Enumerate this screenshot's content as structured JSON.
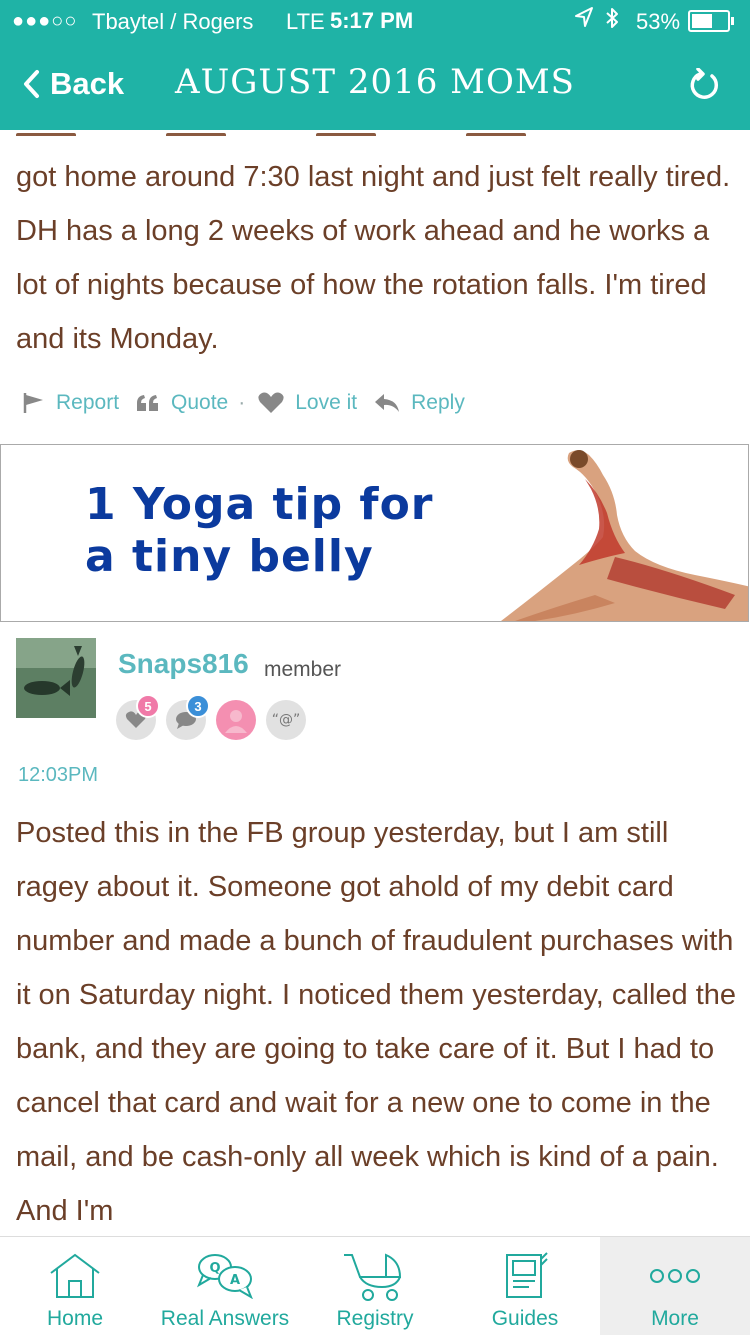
{
  "status_bar": {
    "signal": "●●●○○",
    "carrier": "Tbaytel / Rogers",
    "network": "LTE",
    "time": "5:17 PM",
    "battery": "53%",
    "battery_level": 0.53
  },
  "nav": {
    "back_label": "Back",
    "title": "AUGUST 2016 MOMS"
  },
  "previous_post": {
    "text": "got home around 7:30 last night and just felt really tired. DH has a long 2 weeks of work ahead and he works a lot of nights because of how the rotation falls. I'm tired and its Monday.",
    "actions": {
      "report": "Report",
      "quote": "Quote",
      "separator": "·",
      "love": "Love it",
      "reply": "Reply"
    }
  },
  "ad": {
    "line1": "1 Yoga tip for",
    "line2": "a tiny belly"
  },
  "comment": {
    "username": "Snaps816",
    "role": "member",
    "badges": [
      {
        "icon": "heart-icon",
        "count": "5",
        "color": "#f07aa8"
      },
      {
        "icon": "chat-bubble-icon",
        "count": "3",
        "color": "#3b8fd8"
      },
      {
        "icon": "person-icon",
        "count": "",
        "color": "#f48fb1"
      },
      {
        "icon": "mention-icon",
        "label": "“@”"
      }
    ],
    "time": "12:03PM",
    "text": "Posted this in the FB group yesterday, but I am still ragey about it. Someone got ahold of my debit card number and made a bunch of fraudulent purchases with it on Saturday night. I noticed them yesterday, called the bank, and they are going to take care of it. But I had to cancel that card and wait for a new one to come in the mail, and be cash-only all week which is kind of a pain. And I'm"
  },
  "tabbar": {
    "tabs": [
      {
        "label": "Home",
        "icon": "home-icon"
      },
      {
        "label": "Real Answers",
        "icon": "qa-bubbles-icon"
      },
      {
        "label": "Registry",
        "icon": "stroller-icon"
      },
      {
        "label": "Guides",
        "icon": "guide-book-icon"
      },
      {
        "label": "More",
        "icon": "more-dots-icon",
        "active": true
      }
    ]
  },
  "colors": {
    "brand_teal": "#1fb3a6",
    "link_teal": "#5bb8bf",
    "body_text": "#6b3f28",
    "ad_blue": "#0b3a9e"
  }
}
